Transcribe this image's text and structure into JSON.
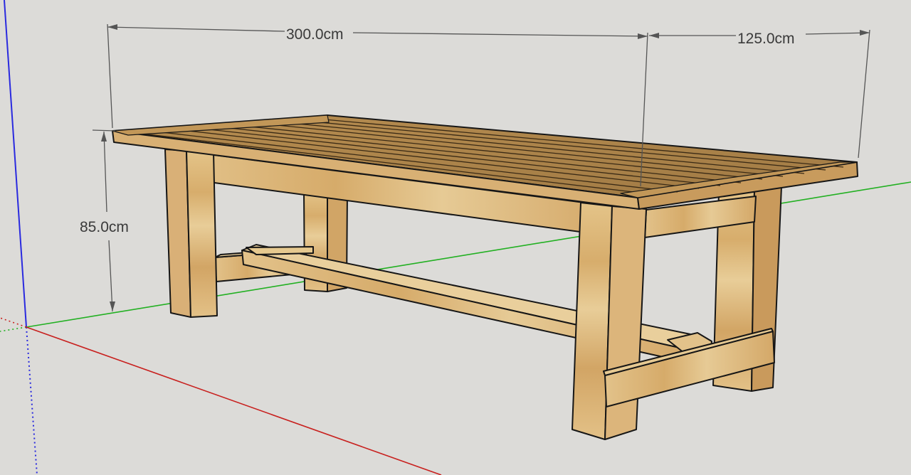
{
  "app": {
    "view": "3d-model-viewport"
  },
  "model": {
    "object": "trestle table",
    "dimensions": {
      "length_label": "300.0cm",
      "width_label": "125.0cm",
      "height_label": "85.0cm"
    }
  },
  "axes": {
    "red": "#c8201e",
    "green": "#22b022",
    "blue": "#2a2adf"
  },
  "colors": {
    "background": "#dcdbd8",
    "wood_light": "#e2c189",
    "wood_mid": "#cfa364",
    "wood_dark": "#8a6a3a",
    "outline": "#161616",
    "dimension_line": "#555555"
  }
}
